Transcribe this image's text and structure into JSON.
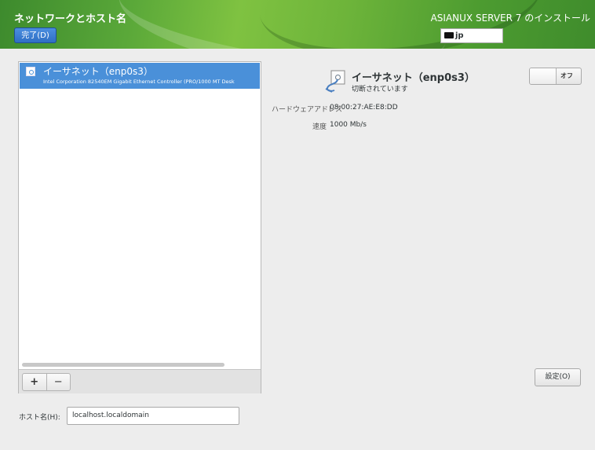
{
  "header": {
    "title": "ネットワークとホスト名",
    "done_label": "完了(D)",
    "install_title": "ASIANUX SERVER 7 のインストール",
    "keyboard_layout": "jp"
  },
  "interfaces": [
    {
      "name": "イーサネット（enp0s3）",
      "description": "Intel Corporation 82540EM Gigabit Ethernet Controller (PRO/1000 MT Desk",
      "selected": true
    }
  ],
  "toolbar": {
    "add_label": "+",
    "remove_label": "−"
  },
  "detail": {
    "name": "イーサネット（enp0s3）",
    "status": "切断されています",
    "toggle_label": "オフ",
    "hw_address_label": "ハードウェアアドレス",
    "hw_address_value": "08:00:27:AE:E8:DD",
    "speed_label": "速度",
    "speed_value": "1000 Mb/s",
    "settings_label": "設定(O)"
  },
  "hostname": {
    "label": "ホスト名(H):",
    "value": "localhost.localdomain"
  },
  "colors": {
    "header_green": "#5aa839",
    "selection_blue": "#4a90d9",
    "done_button_blue": "#2f6fc4"
  }
}
